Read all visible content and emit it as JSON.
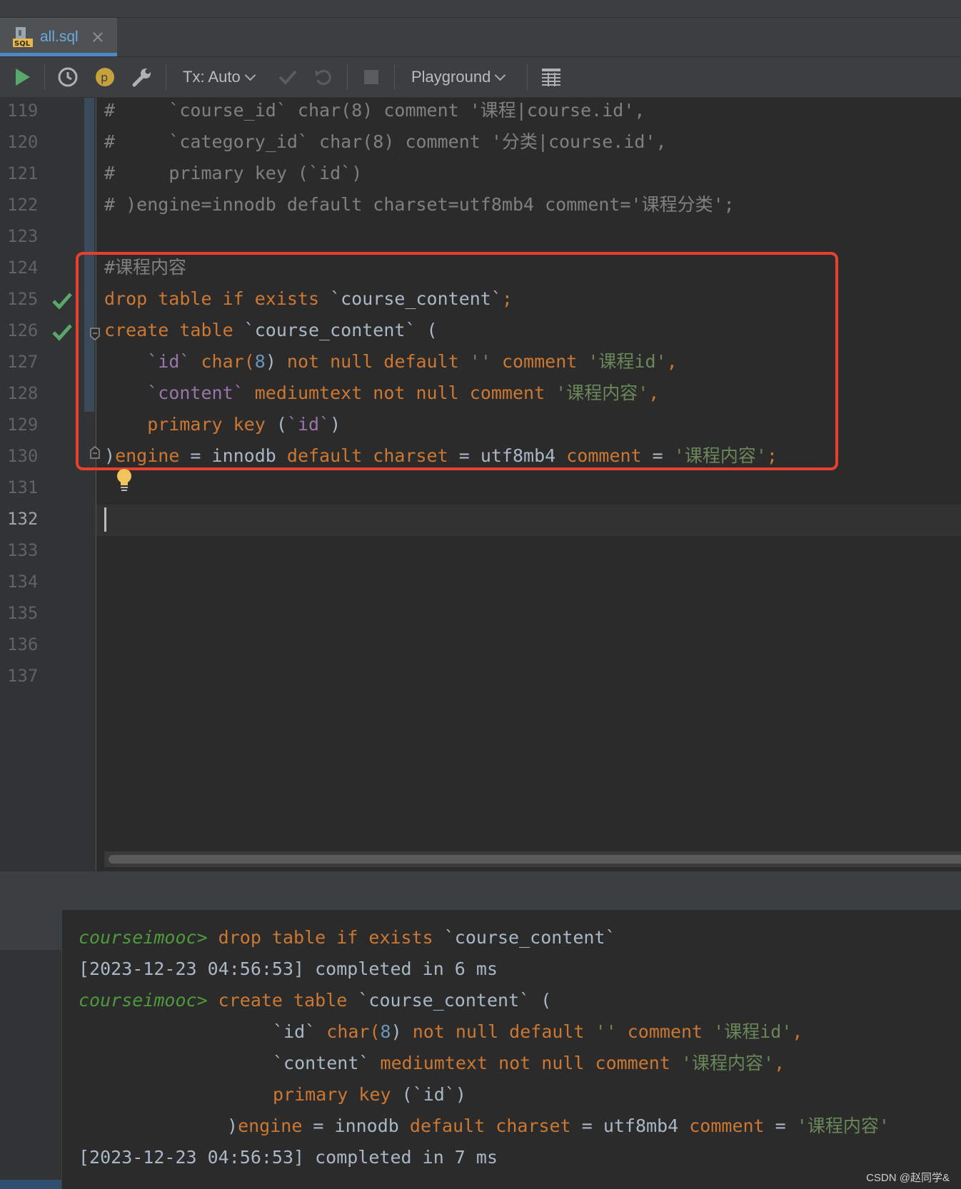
{
  "tab": {
    "label": "all.sql",
    "icon": "sql-file-icon"
  },
  "toolbar": {
    "tx_label": "Tx: Auto",
    "playground_label": "Playground"
  },
  "editor": {
    "line_numbers": [
      "119",
      "120",
      "121",
      "122",
      "123",
      "124",
      "125",
      "126",
      "127",
      "128",
      "129",
      "130",
      "131",
      "132",
      "133",
      "134",
      "135",
      "136",
      "137"
    ],
    "current_line": "132",
    "lines": {
      "l119": {
        "hash": "#",
        "rest": "     `course_id` char(8) comment '课程|course.id',"
      },
      "l120": {
        "hash": "#",
        "rest": "     `category_id` char(8) comment '分类|course.id',"
      },
      "l121": {
        "hash": "#",
        "rest": "     primary key (`id`)"
      },
      "l122": {
        "hash": "#",
        "rest": " )engine=innodb default charset=utf8mb4 comment='课程分类';"
      },
      "l124": {
        "comment": "#课程内容"
      },
      "l125": {
        "kw1": "drop table if exists",
        "ident": " `course_content`",
        "semi": ";"
      },
      "l126": {
        "kw1": "create table",
        "ident": " `course_content`",
        "paren": " ("
      },
      "l127": {
        "indent": "    ",
        "col": "`id`",
        "type": " char(",
        "num": "8",
        "close": ")",
        "kw": " not null default",
        "str1": " ''",
        "kw2": " comment",
        "str2": " '课程id'",
        "comma": ","
      },
      "l128": {
        "indent": "    ",
        "col": "`content`",
        "kw": " mediumtext not null comment",
        "str2": " '课程内容'",
        "comma": ","
      },
      "l129": {
        "indent": "    ",
        "kw": "primary key",
        "paren": " (",
        "col": "`id`",
        "close": ")"
      },
      "l130": {
        "paren": ")",
        "kw1": "engine",
        "eq1": " = innodb ",
        "kw2": "default charset",
        "eq2": " = utf8mb4 ",
        "kw3": "comment",
        "eq3": " = ",
        "str": "'课程内容'",
        "semi": ";"
      }
    }
  },
  "console": {
    "prompt": "courseimooc>",
    "cmd1": " drop table if exists `course_content`",
    "cmd1_kw": " drop table if exists",
    "cmd1_ident": " `course_content`",
    "result1": "[2023-12-23 04:56:53] completed in 6 ms",
    "cmd2_kw": " create table",
    "cmd2_ident": " `course_content`",
    "cmd2_paren": " (",
    "c127_col": "`id`",
    "c127_type": " char(",
    "c127_num": "8",
    "c127_close": ")",
    "c127_kw": " not null default",
    "c127_str1": " ''",
    "c127_kw2": " comment",
    "c127_str2": " '课程id'",
    "c127_comma": ",",
    "c128_col": "`content`",
    "c128_kw": " mediumtext not null comment",
    "c128_str": " '课程内容'",
    "c128_comma": ",",
    "c129_kw": "primary key",
    "c129_paren": " (",
    "c129_col": "`id`",
    "c129_close": ")",
    "c130_paren": ")",
    "c130_kw1": "engine",
    "c130_eq1": " = innodb ",
    "c130_kw2": "default charset",
    "c130_eq2": " = utf8mb4 ",
    "c130_kw3": "comment",
    "c130_eq3": " = ",
    "c130_str": "'课程内容'",
    "result2": "[2023-12-23 04:56:53] completed in 7 ms"
  },
  "watermark": "CSDN @赵同学&",
  "colors": {
    "keyword": "#cc7832",
    "string": "#6a8759",
    "identifier": "#9876aa",
    "number": "#6897bb",
    "highlight_box": "#e8402f",
    "run_green": "#4e9a3d"
  }
}
